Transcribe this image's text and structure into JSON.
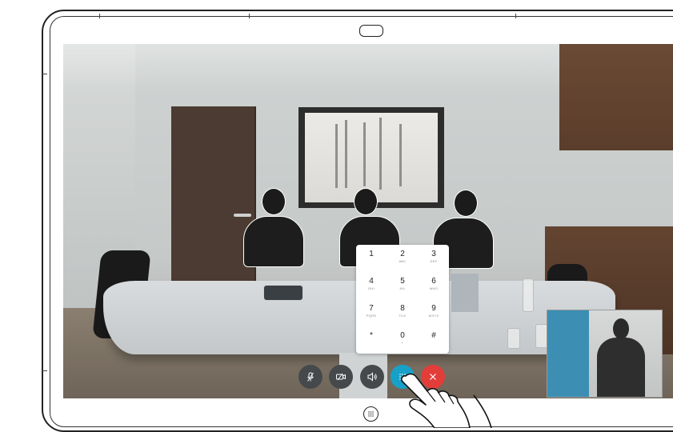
{
  "keypad": {
    "keys": [
      {
        "num": "1",
        "sub": ""
      },
      {
        "num": "2",
        "sub": "ABC"
      },
      {
        "num": "3",
        "sub": "DEF"
      },
      {
        "num": "4",
        "sub": "GHI"
      },
      {
        "num": "5",
        "sub": "JKL"
      },
      {
        "num": "6",
        "sub": "MNO"
      },
      {
        "num": "7",
        "sub": "PQRS"
      },
      {
        "num": "8",
        "sub": "TUV"
      },
      {
        "num": "9",
        "sub": "WXYZ"
      },
      {
        "num": "*",
        "sub": ""
      },
      {
        "num": "0",
        "sub": "+"
      },
      {
        "num": "#",
        "sub": ""
      }
    ]
  },
  "controls": {
    "mute": "mic-off-icon",
    "camera": "camera-off-icon",
    "volume": "speaker-icon",
    "keypad": "keypad-icon",
    "end_call": "end-call-icon"
  },
  "colors": {
    "keypad_button": "#18a1c8",
    "end_call": "#e33d3a",
    "control_dark": "#45494b"
  }
}
